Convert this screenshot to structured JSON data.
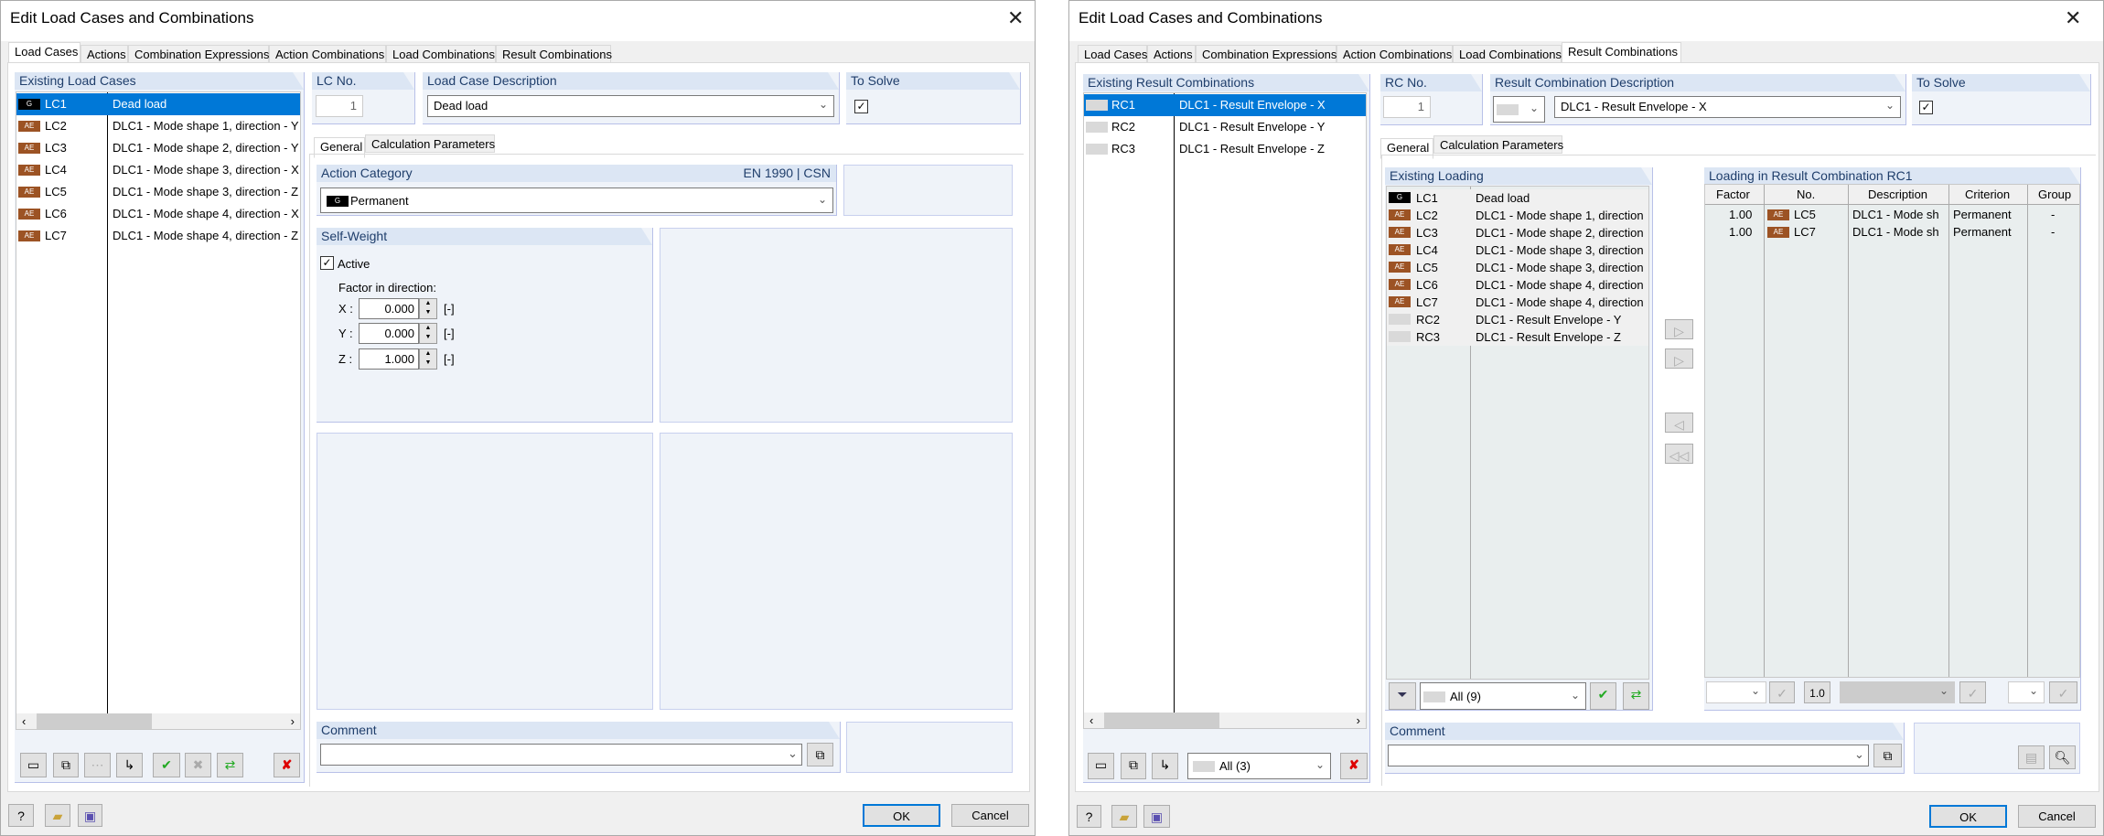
{
  "left_dialog": {
    "title": "Edit Load Cases and Combinations",
    "tabs": [
      "Load Cases",
      "Actions",
      "Combination Expressions",
      "Action Combinations",
      "Load Combinations",
      "Result Combinations"
    ],
    "active_tab": "Load Cases",
    "existing_header": "Existing Load Cases",
    "load_cases": [
      {
        "badge": "G",
        "id": "LC1",
        "desc": "Dead load",
        "selected": true
      },
      {
        "badge": "AE",
        "id": "LC2",
        "desc": "DLC1 - Mode shape 1, direction - Y"
      },
      {
        "badge": "AE",
        "id": "LC3",
        "desc": "DLC1 - Mode shape 2, direction - Y"
      },
      {
        "badge": "AE",
        "id": "LC4",
        "desc": "DLC1 - Mode shape 3, direction - X"
      },
      {
        "badge": "AE",
        "id": "LC5",
        "desc": "DLC1 - Mode shape 3, direction - Z"
      },
      {
        "badge": "AE",
        "id": "LC6",
        "desc": "DLC1 - Mode shape 4, direction - X"
      },
      {
        "badge": "AE",
        "id": "LC7",
        "desc": "DLC1 - Mode shape 4, direction - Z"
      }
    ],
    "lc_no_label": "LC No.",
    "lc_no": "1",
    "desc_label": "Load Case Description",
    "desc_value": "Dead load",
    "to_solve_label": "To Solve",
    "to_solve": true,
    "subtabs": [
      "General",
      "Calculation Parameters"
    ],
    "action_category_label": "Action Category",
    "standard": "EN 1990 | CSN",
    "action_category_badge": "G",
    "action_category": "Permanent",
    "self_weight_label": "Self-Weight",
    "active_label": "Active",
    "active": true,
    "factor_label": "Factor in direction:",
    "factors": [
      {
        "axis": "X :",
        "value": "0.000",
        "unit": "[-]"
      },
      {
        "axis": "Y :",
        "value": "0.000",
        "unit": "[-]"
      },
      {
        "axis": "Z :",
        "value": "1.000",
        "unit": "[-]"
      }
    ],
    "comment_label": "Comment",
    "comment": "",
    "ok": "OK",
    "cancel": "Cancel"
  },
  "right_dialog": {
    "title": "Edit Load Cases and Combinations",
    "tabs": [
      "Load Cases",
      "Actions",
      "Combination Expressions",
      "Action Combinations",
      "Load Combinations",
      "Result Combinations"
    ],
    "active_tab": "Result Combinations",
    "existing_header": "Existing Result Combinations",
    "result_combinations": [
      {
        "id": "RC1",
        "desc": "DLC1 - Result Envelope - X",
        "selected": true
      },
      {
        "id": "RC2",
        "desc": "DLC1 - Result Envelope - Y"
      },
      {
        "id": "RC3",
        "desc": "DLC1 - Result Envelope - Z"
      }
    ],
    "filter_all": "All (3)",
    "rc_no_label": "RC No.",
    "rc_no": "1",
    "desc_label": "Result Combination Description",
    "desc_value": "DLC1 - Result Envelope - X",
    "to_solve_label": "To Solve",
    "to_solve": true,
    "subtabs": [
      "General",
      "Calculation Parameters"
    ],
    "existing_loading_header": "Existing Loading",
    "existing_loading": [
      {
        "badge": "G",
        "id": "LC1",
        "desc": "Dead load"
      },
      {
        "badge": "AE",
        "id": "LC2",
        "desc": "DLC1 - Mode shape 1, direction"
      },
      {
        "badge": "AE",
        "id": "LC3",
        "desc": "DLC1 - Mode shape 2, direction"
      },
      {
        "badge": "AE",
        "id": "LC4",
        "desc": "DLC1 - Mode shape 3, direction"
      },
      {
        "badge": "AE",
        "id": "LC5",
        "desc": "DLC1 - Mode shape 3, direction"
      },
      {
        "badge": "AE",
        "id": "LC6",
        "desc": "DLC1 - Mode shape 4, direction"
      },
      {
        "badge": "AE",
        "id": "LC7",
        "desc": "DLC1 - Mode shape 4, direction"
      },
      {
        "badge": "",
        "id": "RC2",
        "desc": "DLC1 - Result Envelope - Y"
      },
      {
        "badge": "",
        "id": "RC3",
        "desc": "DLC1 - Result Envelope - Z"
      }
    ],
    "loading_filter": "All (9)",
    "loading_in_rc_header": "Loading in Result Combination RC1",
    "columns": [
      "Factor",
      "No.",
      "Description",
      "Criterion",
      "Group"
    ],
    "loading_rows": [
      {
        "factor": "1.00",
        "badge": "AE",
        "no": "LC5",
        "desc": "DLC1 - Mode sh",
        "criterion": "Permanent",
        "group": "-"
      },
      {
        "factor": "1.00",
        "badge": "AE",
        "no": "LC7",
        "desc": "DLC1 - Mode sh",
        "criterion": "Permanent",
        "group": "-"
      }
    ],
    "factor_button": "1.0",
    "comment_label": "Comment",
    "comment": "",
    "ok": "OK",
    "cancel": "Cancel"
  },
  "colors": {
    "selection": "#0078d7",
    "ae_badge": "#9c5324",
    "g_badge": "#000000",
    "header": "#dce6f4"
  }
}
